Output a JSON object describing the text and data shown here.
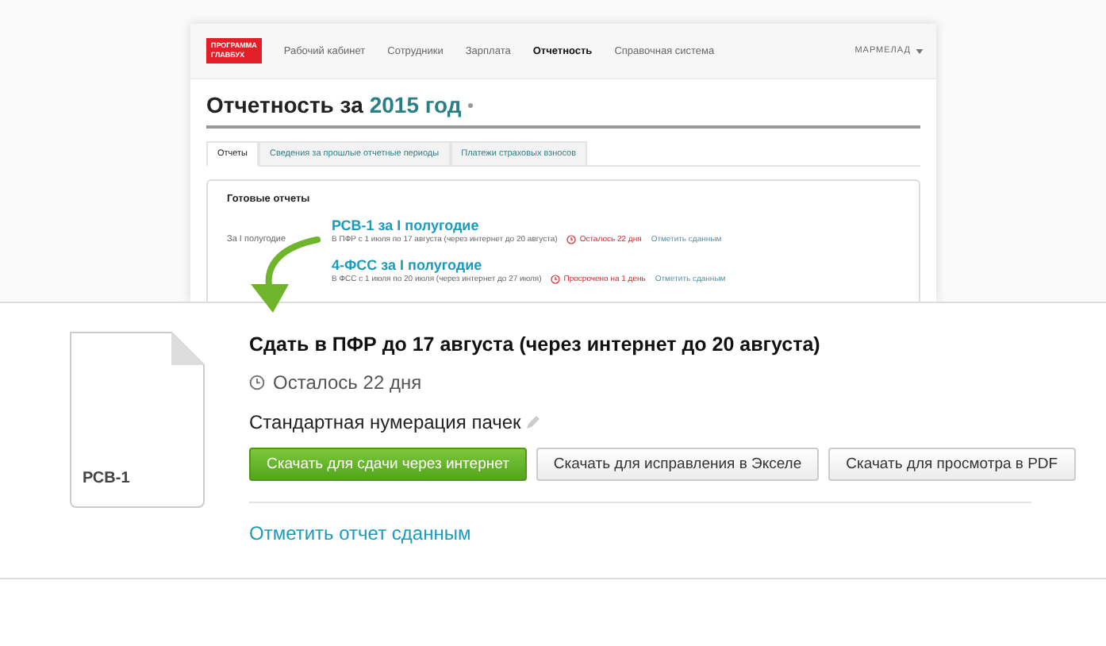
{
  "app": {
    "logo": [
      "ПРОГРАММА",
      "ГЛАВБУХ"
    ],
    "nav": [
      {
        "label": "Рабочий кабинет",
        "selected": false
      },
      {
        "label": "Сотрудники",
        "selected": false
      },
      {
        "label": "Зарплата",
        "selected": false
      },
      {
        "label": "Отчетность",
        "selected": true
      },
      {
        "label": "Справочная система",
        "selected": false
      }
    ],
    "user": "МАРМЕЛАД",
    "page_title": {
      "text": "Отчетность за",
      "year": "2015 год"
    },
    "tabs": [
      {
        "label": "Отчеты",
        "selected": true
      },
      {
        "label": "Сведения за прошлые отчетные периоды",
        "selected": false
      },
      {
        "label": "Платежи страховых взносов",
        "selected": false
      }
    ],
    "reports_section": {
      "title": "Готовые отчеты",
      "period": "За I полугодие",
      "reports": [
        {
          "title": "РСВ-1 за I полугодие",
          "details": "В ПФР с 1 июля по 17 августа (через интернет до 20 августа)",
          "status": "Осталось 22 дня",
          "action": "Отметить сданным"
        },
        {
          "title": "4-ФСС за I полугодие",
          "details": "В ФСС с 1 июля по 20 июля (через интернет до 27 июля)",
          "status": "Просрочено на 1 день",
          "action": "Отметить сданным"
        }
      ]
    }
  },
  "detail": {
    "file_label": "РСВ-1",
    "heading": "Сдать в ПФР до 17 августа (через интернет до 20 августа)",
    "remaining": "Осталось 22 дня",
    "numbering": "Стандартная нумерация пачек",
    "buttons": [
      {
        "label": "Скачать для сдачи через интернет",
        "primary": true
      },
      {
        "label": "Скачать для исправления в Экселе",
        "primary": false
      },
      {
        "label": "Скачать для просмотра в PDF",
        "primary": false
      }
    ],
    "link": "Отметить отчет сданным"
  }
}
